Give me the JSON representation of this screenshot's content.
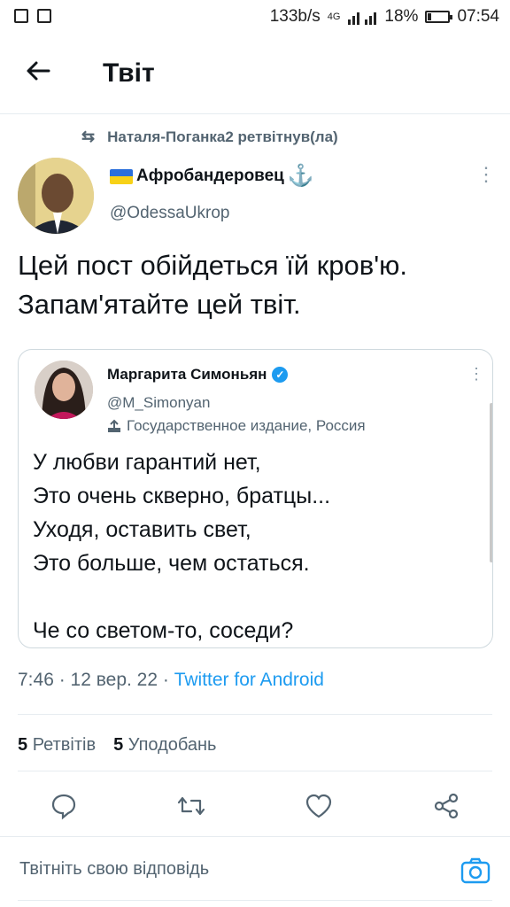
{
  "status_bar": {
    "net_speed": "133b/s",
    "network": "4G",
    "battery_percent": "18%",
    "battery_level": 0.18,
    "time": "07:54"
  },
  "header": {
    "title": "Твіт",
    "back_icon": "arrow-left-icon"
  },
  "retweet_line": {
    "text": "Наталя-Поганка2 ретвітнув(ла)"
  },
  "author": {
    "name": "Афробандеровец",
    "handle": "@OdessaUkrop",
    "name_prefix_icon": "ukraine-flag-icon",
    "name_suffix_icon": "anchor-icon"
  },
  "tweet": {
    "text": "Цей пост обійдеться їй кров'ю. Запам'ятайте цей твіт."
  },
  "quoted": {
    "name": "Маргарита Симоньян",
    "handle": "@M_Simonyan",
    "label": "Государственное издание, Россия",
    "text": "У любви гарантий нет,\nЭто очень скверно, братцы...\nУходя, оставить свет,\nЭто больше, чем остаться.\n\nЧе со светом-то, соседи?"
  },
  "meta": {
    "time_date": "7:46 · 12 вер. 22 · ",
    "source": "Twitter for Android"
  },
  "stats": {
    "retweets_count": "5",
    "retweets_label": "Ретвітів",
    "likes_count": "5",
    "likes_label": "Уподобань"
  },
  "reply": {
    "placeholder": "Твітніть свою відповідь"
  },
  "colors": {
    "accent": "#1d9bf0",
    "secondary_text": "#536471",
    "divider": "#e6ecf0"
  }
}
